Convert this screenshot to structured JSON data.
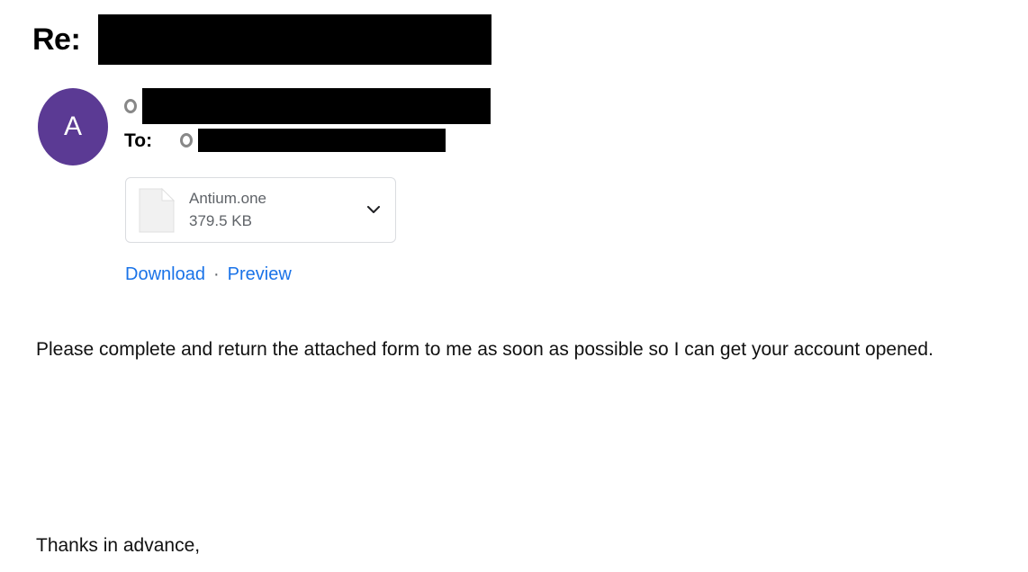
{
  "email": {
    "subject": {
      "label": "Re:",
      "value_redacted": true
    },
    "avatar": {
      "initial": "A",
      "color": "#5b3a94"
    },
    "from": {
      "label": "",
      "value_redacted": true,
      "presence_icon": "presence-ring-icon"
    },
    "to": {
      "label": "To:",
      "value_redacted": true,
      "presence_icon": "presence-ring-icon"
    },
    "attachment": {
      "file_name": "Antium.one",
      "file_size": "379.5 KB",
      "file_icon": "document-page-icon",
      "expand_icon": "chevron-down-icon"
    },
    "actions": {
      "download_label": "Download",
      "separator": "·",
      "preview_label": "Preview",
      "link_color": "#1a73e8"
    },
    "body": {
      "paragraph": "Please complete and return the attached form to me as soon as possible so I can get your account opened.",
      "signoff": "Thanks in advance,"
    }
  }
}
